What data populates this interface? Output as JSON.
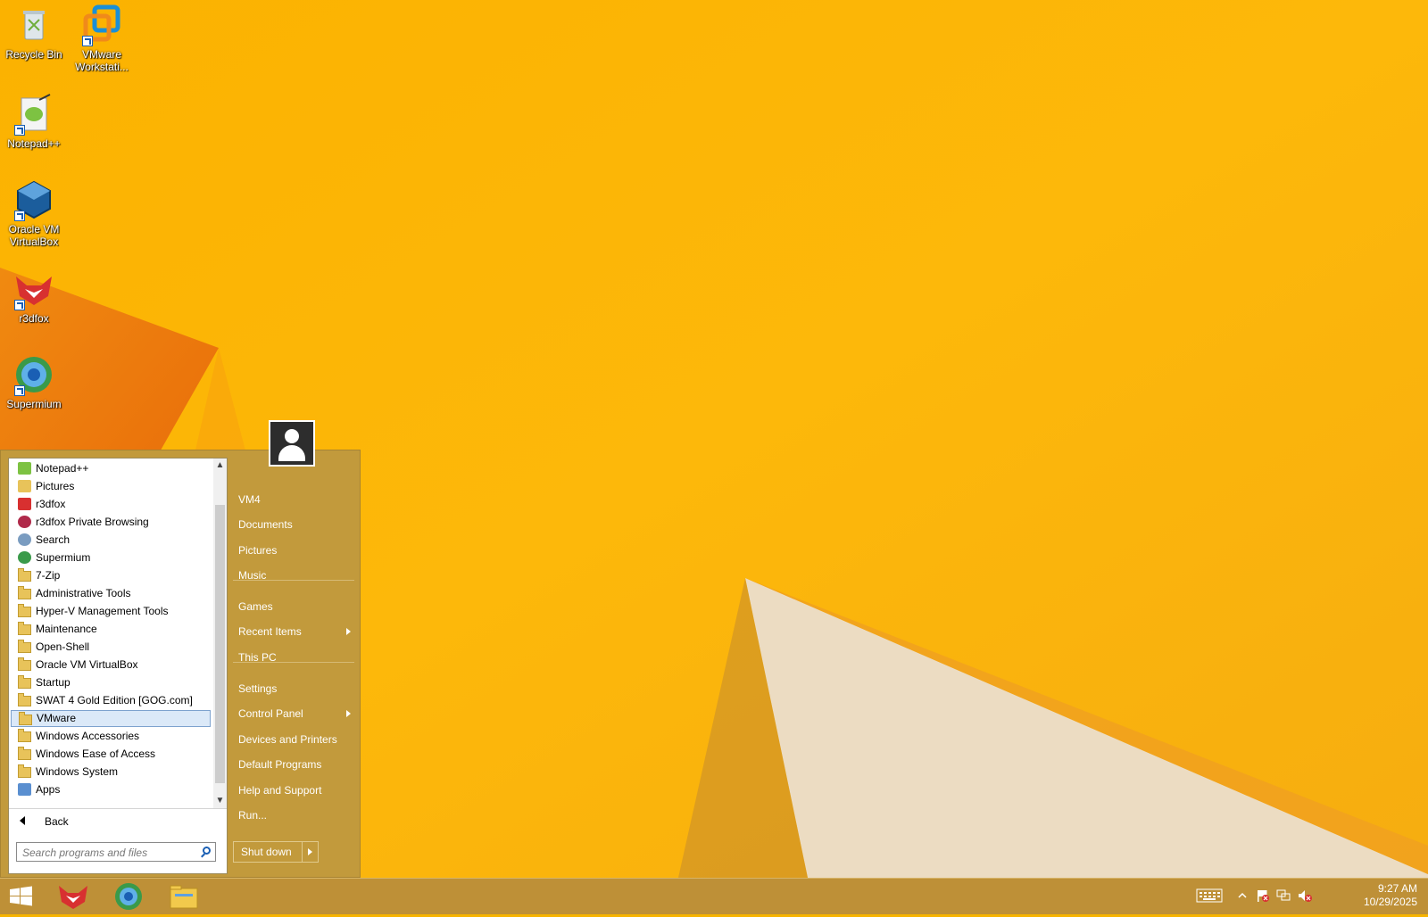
{
  "desktop": {
    "icons": [
      {
        "label": "Recycle Bin",
        "icon": "recycle-bin-icon"
      },
      {
        "label": "VMware Workstati...",
        "icon": "vmware-icon"
      },
      {
        "label": "Notepad++",
        "icon": "notepad-plus-plus-icon"
      },
      {
        "label": "Oracle VM VirtualBox",
        "icon": "virtualbox-icon"
      },
      {
        "label": "r3dfox",
        "icon": "r3dfox-icon"
      },
      {
        "label": "Supermium",
        "icon": "supermium-icon"
      }
    ]
  },
  "start_menu": {
    "programs": [
      {
        "label": "Notepad++",
        "icon": "notepad-plus-plus-icon"
      },
      {
        "label": "Pictures",
        "icon": "pictures-icon"
      },
      {
        "label": "r3dfox",
        "icon": "r3dfox-icon"
      },
      {
        "label": "r3dfox Private Browsing",
        "icon": "r3dfox-private-icon"
      },
      {
        "label": "Search",
        "icon": "search-icon"
      },
      {
        "label": "Supermium",
        "icon": "supermium-icon"
      },
      {
        "label": "7-Zip",
        "icon": "folder-icon"
      },
      {
        "label": "Administrative Tools",
        "icon": "folder-icon"
      },
      {
        "label": "Hyper-V Management Tools",
        "icon": "folder-icon"
      },
      {
        "label": "Maintenance",
        "icon": "folder-icon"
      },
      {
        "label": "Open-Shell",
        "icon": "folder-icon"
      },
      {
        "label": "Oracle VM VirtualBox",
        "icon": "folder-icon"
      },
      {
        "label": "Startup",
        "icon": "folder-icon"
      },
      {
        "label": "SWAT 4 Gold Edition [GOG.com]",
        "icon": "folder-icon"
      },
      {
        "label": "VMware",
        "icon": "folder-icon",
        "selected": true
      },
      {
        "label": "Windows Accessories",
        "icon": "folder-icon"
      },
      {
        "label": "Windows Ease of Access",
        "icon": "folder-icon"
      },
      {
        "label": "Windows System",
        "icon": "folder-icon"
      },
      {
        "label": "Apps",
        "icon": "apps-icon"
      }
    ],
    "back_label": "Back",
    "search_placeholder": "Search programs and files",
    "places": [
      {
        "label": "VM4"
      },
      {
        "label": "Documents"
      },
      {
        "label": "Pictures"
      },
      {
        "label": "Music"
      },
      {
        "label": "Games"
      },
      {
        "label": "Recent Items",
        "submenu": true
      },
      {
        "label": "This PC"
      },
      {
        "label": "Settings"
      },
      {
        "label": "Control Panel",
        "submenu": true
      },
      {
        "label": "Devices and Printers"
      },
      {
        "label": "Default Programs"
      },
      {
        "label": "Help and Support"
      },
      {
        "label": "Run..."
      }
    ],
    "shutdown_label": "Shut down"
  },
  "taskbar": {
    "pinned": [
      {
        "icon": "windows-start-icon"
      },
      {
        "icon": "r3dfox-icon"
      },
      {
        "icon": "supermium-icon"
      },
      {
        "icon": "file-explorer-icon"
      }
    ],
    "tray": {
      "icons": [
        "keyboard-icon",
        "show-hidden-icons-chevron",
        "action-center-flag-icon",
        "network-icon",
        "volume-muted-icon"
      ],
      "time": "9:27 AM",
      "date": "10/29/2025"
    }
  },
  "colors": {
    "wallpaper_base": "#f7b400",
    "menu_background": "#c29a3c",
    "selection_highlight": "#dbe9f8",
    "taskbar": "#ba8e3a"
  }
}
